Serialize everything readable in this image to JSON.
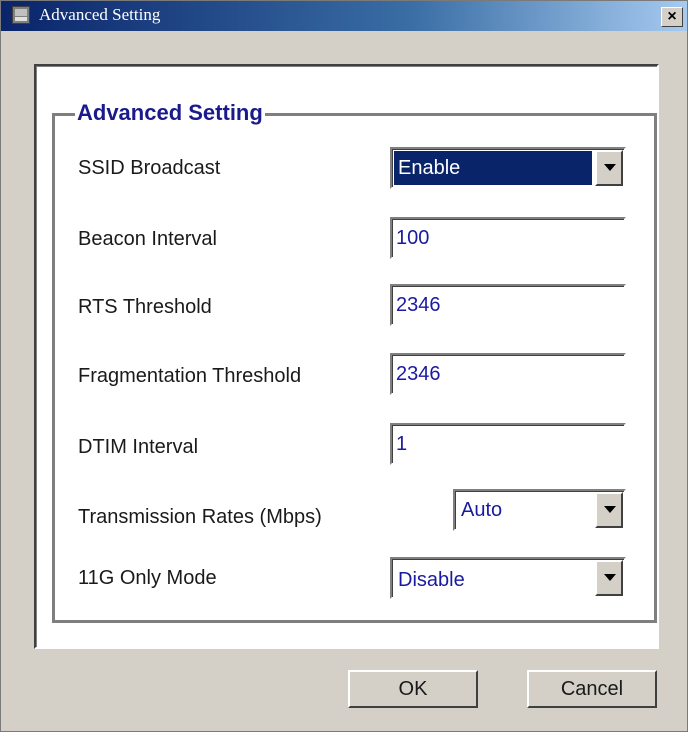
{
  "window": {
    "title": "Advanced Setting",
    "close_label": "×"
  },
  "group": {
    "legend": "Advanced Setting"
  },
  "fields": {
    "ssid_broadcast": {
      "label": "SSID Broadcast",
      "value": "Enable"
    },
    "beacon_interval": {
      "label": "Beacon Interval",
      "value": "100"
    },
    "rts_threshold": {
      "label": "RTS Threshold",
      "value": "2346"
    },
    "fragmentation_threshold": {
      "label": "Fragmentation Threshold",
      "value": "2346"
    },
    "dtim_interval": {
      "label": "DTIM Interval",
      "value": "1"
    },
    "transmission_rates": {
      "label": "Transmission Rates (Mbps)",
      "value": "Auto"
    },
    "g_only_mode": {
      "label": "11G Only Mode",
      "value": "Disable"
    }
  },
  "buttons": {
    "ok": "OK",
    "cancel": "Cancel"
  },
  "colors": {
    "title_bar": "#0a246a",
    "value_text": "#1a1aa0",
    "legend_text": "#1a1a8c",
    "face": "#d4d0c8"
  }
}
